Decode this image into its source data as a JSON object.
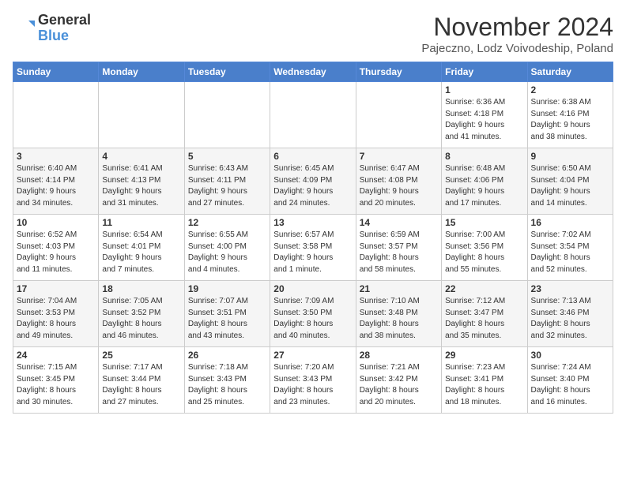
{
  "header": {
    "logo_general": "General",
    "logo_blue": "Blue",
    "month_title": "November 2024",
    "location": "Pajeczno, Lodz Voivodeship, Poland"
  },
  "weekdays": [
    "Sunday",
    "Monday",
    "Tuesday",
    "Wednesday",
    "Thursday",
    "Friday",
    "Saturday"
  ],
  "weeks": [
    [
      {
        "day": "",
        "detail": ""
      },
      {
        "day": "",
        "detail": ""
      },
      {
        "day": "",
        "detail": ""
      },
      {
        "day": "",
        "detail": ""
      },
      {
        "day": "",
        "detail": ""
      },
      {
        "day": "1",
        "detail": "Sunrise: 6:36 AM\nSunset: 4:18 PM\nDaylight: 9 hours\nand 41 minutes."
      },
      {
        "day": "2",
        "detail": "Sunrise: 6:38 AM\nSunset: 4:16 PM\nDaylight: 9 hours\nand 38 minutes."
      }
    ],
    [
      {
        "day": "3",
        "detail": "Sunrise: 6:40 AM\nSunset: 4:14 PM\nDaylight: 9 hours\nand 34 minutes."
      },
      {
        "day": "4",
        "detail": "Sunrise: 6:41 AM\nSunset: 4:13 PM\nDaylight: 9 hours\nand 31 minutes."
      },
      {
        "day": "5",
        "detail": "Sunrise: 6:43 AM\nSunset: 4:11 PM\nDaylight: 9 hours\nand 27 minutes."
      },
      {
        "day": "6",
        "detail": "Sunrise: 6:45 AM\nSunset: 4:09 PM\nDaylight: 9 hours\nand 24 minutes."
      },
      {
        "day": "7",
        "detail": "Sunrise: 6:47 AM\nSunset: 4:08 PM\nDaylight: 9 hours\nand 20 minutes."
      },
      {
        "day": "8",
        "detail": "Sunrise: 6:48 AM\nSunset: 4:06 PM\nDaylight: 9 hours\nand 17 minutes."
      },
      {
        "day": "9",
        "detail": "Sunrise: 6:50 AM\nSunset: 4:04 PM\nDaylight: 9 hours\nand 14 minutes."
      }
    ],
    [
      {
        "day": "10",
        "detail": "Sunrise: 6:52 AM\nSunset: 4:03 PM\nDaylight: 9 hours\nand 11 minutes."
      },
      {
        "day": "11",
        "detail": "Sunrise: 6:54 AM\nSunset: 4:01 PM\nDaylight: 9 hours\nand 7 minutes."
      },
      {
        "day": "12",
        "detail": "Sunrise: 6:55 AM\nSunset: 4:00 PM\nDaylight: 9 hours\nand 4 minutes."
      },
      {
        "day": "13",
        "detail": "Sunrise: 6:57 AM\nSunset: 3:58 PM\nDaylight: 9 hours\nand 1 minute."
      },
      {
        "day": "14",
        "detail": "Sunrise: 6:59 AM\nSunset: 3:57 PM\nDaylight: 8 hours\nand 58 minutes."
      },
      {
        "day": "15",
        "detail": "Sunrise: 7:00 AM\nSunset: 3:56 PM\nDaylight: 8 hours\nand 55 minutes."
      },
      {
        "day": "16",
        "detail": "Sunrise: 7:02 AM\nSunset: 3:54 PM\nDaylight: 8 hours\nand 52 minutes."
      }
    ],
    [
      {
        "day": "17",
        "detail": "Sunrise: 7:04 AM\nSunset: 3:53 PM\nDaylight: 8 hours\nand 49 minutes."
      },
      {
        "day": "18",
        "detail": "Sunrise: 7:05 AM\nSunset: 3:52 PM\nDaylight: 8 hours\nand 46 minutes."
      },
      {
        "day": "19",
        "detail": "Sunrise: 7:07 AM\nSunset: 3:51 PM\nDaylight: 8 hours\nand 43 minutes."
      },
      {
        "day": "20",
        "detail": "Sunrise: 7:09 AM\nSunset: 3:50 PM\nDaylight: 8 hours\nand 40 minutes."
      },
      {
        "day": "21",
        "detail": "Sunrise: 7:10 AM\nSunset: 3:48 PM\nDaylight: 8 hours\nand 38 minutes."
      },
      {
        "day": "22",
        "detail": "Sunrise: 7:12 AM\nSunset: 3:47 PM\nDaylight: 8 hours\nand 35 minutes."
      },
      {
        "day": "23",
        "detail": "Sunrise: 7:13 AM\nSunset: 3:46 PM\nDaylight: 8 hours\nand 32 minutes."
      }
    ],
    [
      {
        "day": "24",
        "detail": "Sunrise: 7:15 AM\nSunset: 3:45 PM\nDaylight: 8 hours\nand 30 minutes."
      },
      {
        "day": "25",
        "detail": "Sunrise: 7:17 AM\nSunset: 3:44 PM\nDaylight: 8 hours\nand 27 minutes."
      },
      {
        "day": "26",
        "detail": "Sunrise: 7:18 AM\nSunset: 3:43 PM\nDaylight: 8 hours\nand 25 minutes."
      },
      {
        "day": "27",
        "detail": "Sunrise: 7:20 AM\nSunset: 3:43 PM\nDaylight: 8 hours\nand 23 minutes."
      },
      {
        "day": "28",
        "detail": "Sunrise: 7:21 AM\nSunset: 3:42 PM\nDaylight: 8 hours\nand 20 minutes."
      },
      {
        "day": "29",
        "detail": "Sunrise: 7:23 AM\nSunset: 3:41 PM\nDaylight: 8 hours\nand 18 minutes."
      },
      {
        "day": "30",
        "detail": "Sunrise: 7:24 AM\nSunset: 3:40 PM\nDaylight: 8 hours\nand 16 minutes."
      }
    ]
  ]
}
